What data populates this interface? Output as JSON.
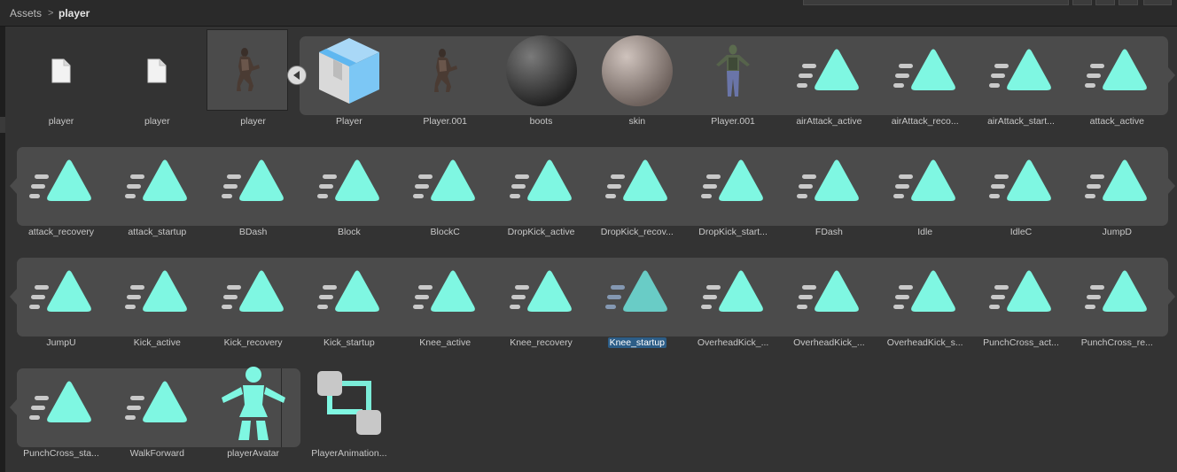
{
  "breadcrumb": {
    "root": "Assets",
    "separator": ">",
    "current": "player"
  },
  "colors": {
    "anim": "#7ff7e2",
    "anim_lines": "#c9c9c9",
    "selection": "#2c5d87"
  },
  "items": [
    {
      "label": "player",
      "icon": "file-icon"
    },
    {
      "label": "player",
      "icon": "file-icon"
    },
    {
      "label": "player",
      "icon": "model-thumbnail-icon"
    },
    {
      "label": "Player",
      "icon": "prefab-box-icon"
    },
    {
      "label": "Player.001",
      "icon": "model-thumbnail-icon"
    },
    {
      "label": "boots",
      "icon": "material-sphere-dark-icon"
    },
    {
      "label": "skin",
      "icon": "material-sphere-light-icon"
    },
    {
      "label": "Player.001",
      "icon": "zombie-model-icon"
    },
    {
      "label": "airAttack_active",
      "icon": "animation-clip-icon"
    },
    {
      "label": "airAttack_reco...",
      "icon": "animation-clip-icon"
    },
    {
      "label": "airAttack_start...",
      "icon": "animation-clip-icon"
    },
    {
      "label": "attack_active",
      "icon": "animation-clip-icon"
    },
    {
      "label": "attack_recovery",
      "icon": "animation-clip-icon"
    },
    {
      "label": "attack_startup",
      "icon": "animation-clip-icon"
    },
    {
      "label": "BDash",
      "icon": "animation-clip-icon"
    },
    {
      "label": "Block",
      "icon": "animation-clip-icon"
    },
    {
      "label": "BlockC",
      "icon": "animation-clip-icon"
    },
    {
      "label": "DropKick_active",
      "icon": "animation-clip-icon"
    },
    {
      "label": "DropKick_recov...",
      "icon": "animation-clip-icon"
    },
    {
      "label": "DropKick_start...",
      "icon": "animation-clip-icon"
    },
    {
      "label": "FDash",
      "icon": "animation-clip-icon"
    },
    {
      "label": "Idle",
      "icon": "animation-clip-icon"
    },
    {
      "label": "IdleC",
      "icon": "animation-clip-icon"
    },
    {
      "label": "JumpD",
      "icon": "animation-clip-icon"
    },
    {
      "label": "JumpU",
      "icon": "animation-clip-icon"
    },
    {
      "label": "Kick_active",
      "icon": "animation-clip-icon"
    },
    {
      "label": "Kick_recovery",
      "icon": "animation-clip-icon"
    },
    {
      "label": "Kick_startup",
      "icon": "animation-clip-icon"
    },
    {
      "label": "Knee_active",
      "icon": "animation-clip-icon"
    },
    {
      "label": "Knee_recovery",
      "icon": "animation-clip-icon"
    },
    {
      "label": "Knee_startup",
      "icon": "animation-clip-icon",
      "selected": true
    },
    {
      "label": "OverheadKick_...",
      "icon": "animation-clip-icon"
    },
    {
      "label": "OverheadKick_...",
      "icon": "animation-clip-icon"
    },
    {
      "label": "OverheadKick_s...",
      "icon": "animation-clip-icon"
    },
    {
      "label": "PunchCross_act...",
      "icon": "animation-clip-icon"
    },
    {
      "label": "PunchCross_re...",
      "icon": "animation-clip-icon"
    },
    {
      "label": "PunchCross_sta...",
      "icon": "animation-clip-icon"
    },
    {
      "label": "WalkForward",
      "icon": "animation-clip-icon"
    },
    {
      "label": "playerAvatar",
      "icon": "avatar-icon"
    },
    {
      "label": "PlayerAnimation...",
      "icon": "animator-controller-icon"
    }
  ]
}
